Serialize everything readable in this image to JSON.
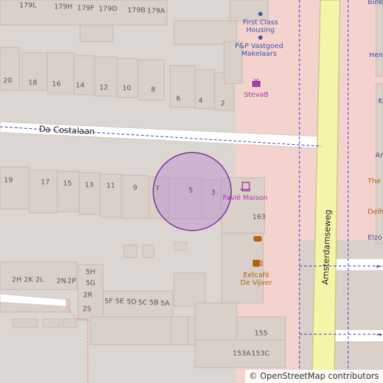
{
  "map": {
    "colors": {
      "background": "#dcd6d2",
      "building": "#d9d0c9",
      "building_stroke": "#c4b8ae",
      "commercial": "#f4d3cf",
      "road": "#ffffff",
      "main_road": "#f5f5a8",
      "main_road_casing": "#c8c885",
      "cycleway": "#2a36d1",
      "footpath": "#e8846e",
      "marker_fill": "#b88ad1",
      "marker_stroke": "#7a2e8e"
    },
    "streets": [
      {
        "name": "Da Costalaan"
      },
      {
        "name": "Amsterdamseweg"
      }
    ],
    "house_numbers": [
      "179L",
      "179H",
      "179F",
      "179D",
      "179B",
      "179A",
      "20",
      "18",
      "16",
      "14",
      "12",
      "10",
      "8",
      "6",
      "4",
      "2",
      "19",
      "17",
      "15",
      "13",
      "11",
      "9",
      "7",
      "5",
      "3",
      "163",
      "5H",
      "5G",
      "2R",
      "2S",
      "2H",
      "2K",
      "2L",
      "2N",
      "2P",
      "5F",
      "5E",
      "5D",
      "5C",
      "5B",
      "5A",
      "155",
      "153A",
      "153C"
    ],
    "pois": [
      {
        "name": "First Class Housing",
        "icon": "dot-icon",
        "line1": "First Class",
        "line2": "Housing"
      },
      {
        "name": "P&P Vastgoed Makelaars",
        "icon": "dot-icon",
        "line1": "P&P Vastgoed",
        "line2": "Makelaars"
      },
      {
        "name": "StevaB",
        "icon": "tv-icon",
        "line1": "StevaB"
      },
      {
        "name": "Favié Maison",
        "icon": "boutique-icon",
        "line1": "Favié Maison"
      },
      {
        "name": "Eetcafé De Vijver",
        "icon": "pub-icon",
        "line1": "Eetcafé",
        "line2": "De Vijver"
      }
    ],
    "edge_labels": [
      "Bink",
      "Henn",
      "Ar",
      "The F",
      "Delh",
      "Elzo",
      "K"
    ],
    "marker": {
      "type": "location-circle"
    },
    "attribution": {
      "symbol": "©",
      "text": "OpenStreetMap contributors"
    }
  }
}
